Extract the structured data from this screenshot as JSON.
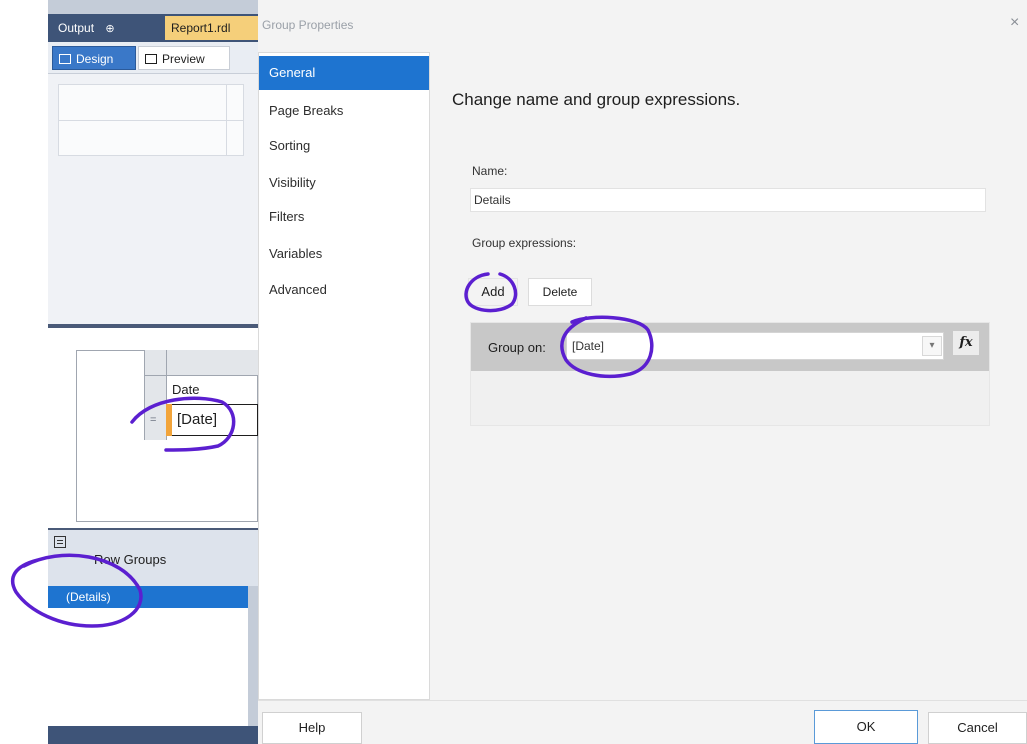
{
  "ide": {
    "tab_output": "Output",
    "tab_report": "Report1.rdl",
    "design_label": "Design",
    "preview_label": "Preview"
  },
  "report_table": {
    "header_label": "Date",
    "cell_value": "[Date]",
    "row_marker": "="
  },
  "row_groups": {
    "title": "Row Groups",
    "items": [
      {
        "label": "(Details)"
      }
    ]
  },
  "dialog": {
    "title": "Group Properties",
    "close_glyph": "×",
    "nav": [
      {
        "label": "General",
        "active": true
      },
      {
        "label": "Page Breaks"
      },
      {
        "label": "Sorting"
      },
      {
        "label": "Visibility"
      },
      {
        "label": "Filters"
      },
      {
        "label": "Variables"
      },
      {
        "label": "Advanced"
      }
    ],
    "general": {
      "heading": "Change name and group expressions.",
      "name_label": "Name:",
      "name_value": "Details",
      "group_expressions_label": "Group expressions:",
      "add_label": "Add",
      "delete_label": "Delete",
      "group_on_label": "Group on:",
      "group_on_value": "[Date]",
      "fx_label": "fx"
    },
    "footer": {
      "help_label": "Help",
      "ok_label": "OK",
      "cancel_label": "Cancel"
    }
  },
  "colors": {
    "accent_blue": "#1e74d0",
    "annotation_purple": "#5b1fd0",
    "report_tab": "#f5cf7a",
    "ide_dark": "#3e5478"
  }
}
